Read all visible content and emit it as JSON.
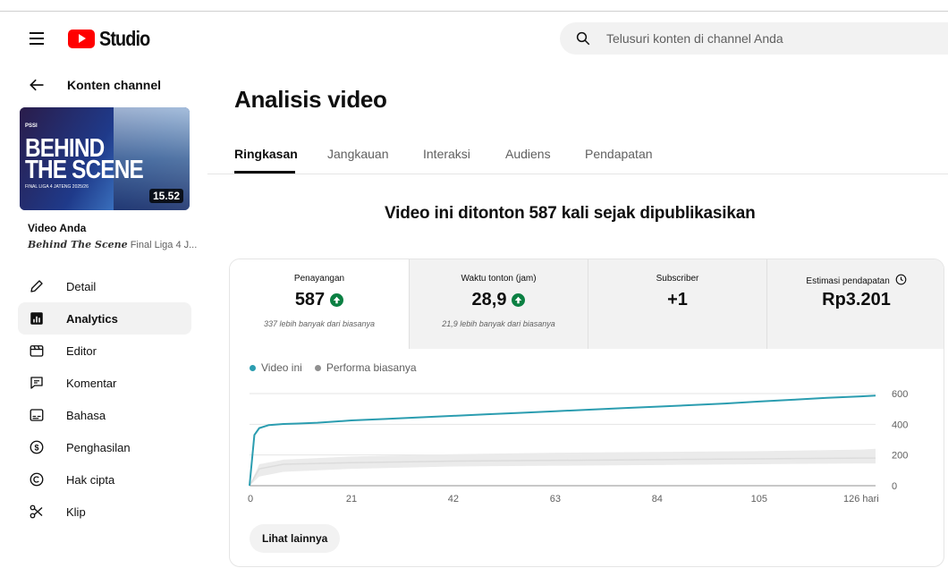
{
  "header": {
    "app_name": "Studio",
    "search_placeholder": "Telusuri konten di channel Anda"
  },
  "sidebar": {
    "back_label": "Konten channel",
    "thumbnail": {
      "tag": "PSSI",
      "title_line1": "BEHIND",
      "title_line2": "THE SCENE",
      "subtitle": "FINAL LIGA 4 JATENG 2025/26",
      "duration": "15.52"
    },
    "your_video_label": "Video Anda",
    "video_title_bold": "Behind The Scene",
    "video_title_rest": " Final Liga 4 J...",
    "items": [
      {
        "label": "Detail",
        "icon": "pencil-icon",
        "active": false
      },
      {
        "label": "Analytics",
        "icon": "analytics-icon",
        "active": true
      },
      {
        "label": "Editor",
        "icon": "clapperboard-icon",
        "active": false
      },
      {
        "label": "Komentar",
        "icon": "comment-icon",
        "active": false
      },
      {
        "label": "Bahasa",
        "icon": "subtitles-icon",
        "active": false
      },
      {
        "label": "Penghasilan",
        "icon": "dollar-icon",
        "active": false
      },
      {
        "label": "Hak cipta",
        "icon": "copyright-icon",
        "active": false
      },
      {
        "label": "Klip",
        "icon": "scissors-icon",
        "active": false
      }
    ]
  },
  "main": {
    "page_title": "Analisis video",
    "tabs": [
      "Ringkasan",
      "Jangkauan",
      "Interaksi",
      "Audiens",
      "Pendapatan"
    ],
    "headline": "Video ini ditonton 587 kali sejak dipublikasikan",
    "metrics": [
      {
        "label": "Penayangan",
        "value": "587",
        "trend": "up",
        "note": "337 lebih banyak dari biasanya"
      },
      {
        "label": "Waktu tonton (jam)",
        "value": "28,9",
        "trend": "up",
        "note": "21,9 lebih banyak dari biasanya"
      },
      {
        "label": "Subscriber",
        "value": "+1",
        "trend": "",
        "note": ""
      },
      {
        "label": "Estimasi pendapatan",
        "value": "Rp3.201",
        "trend": "",
        "note": ""
      }
    ],
    "see_more_label": "Lihat lainnya"
  },
  "colors": {
    "brand_red": "#ff0000",
    "this_video": "#2b9db0",
    "typical": "#909090",
    "trend_up": "#0b8043"
  },
  "chart_data": {
    "type": "line",
    "series": [
      {
        "name": "Video ini",
        "x": [
          0,
          1,
          2,
          4,
          7,
          10,
          14,
          21,
          28,
          35,
          42,
          49,
          56,
          63,
          70,
          77,
          84,
          91,
          98,
          105,
          112,
          119,
          126,
          129
        ],
        "y": [
          0,
          330,
          375,
          395,
          402,
          405,
          410,
          425,
          435,
          445,
          455,
          465,
          475,
          485,
          495,
          505,
          515,
          525,
          535,
          548,
          560,
          572,
          582,
          587
        ]
      },
      {
        "name": "Performa biasanya",
        "type": "band",
        "x": [
          0,
          2,
          7,
          21,
          42,
          63,
          84,
          105,
          126,
          129
        ],
        "low": [
          0,
          60,
          90,
          110,
          125,
          130,
          135,
          140,
          145,
          145
        ],
        "high": [
          0,
          140,
          170,
          190,
          205,
          215,
          220,
          225,
          235,
          240
        ],
        "median": [
          0,
          110,
          140,
          150,
          160,
          165,
          170,
          175,
          180,
          180
        ]
      }
    ],
    "x_ticks": [
      "0",
      "21",
      "42",
      "63",
      "84",
      "105",
      "126 hari"
    ],
    "x_tick_values": [
      0,
      21,
      42,
      63,
      84,
      105,
      126
    ],
    "y_ticks": [
      "0",
      "200",
      "400",
      "600"
    ],
    "y_tick_values": [
      0,
      200,
      400,
      600
    ],
    "xlim": [
      0,
      129
    ],
    "ylim": [
      0,
      600
    ],
    "grid": true,
    "legend": "top-left"
  }
}
